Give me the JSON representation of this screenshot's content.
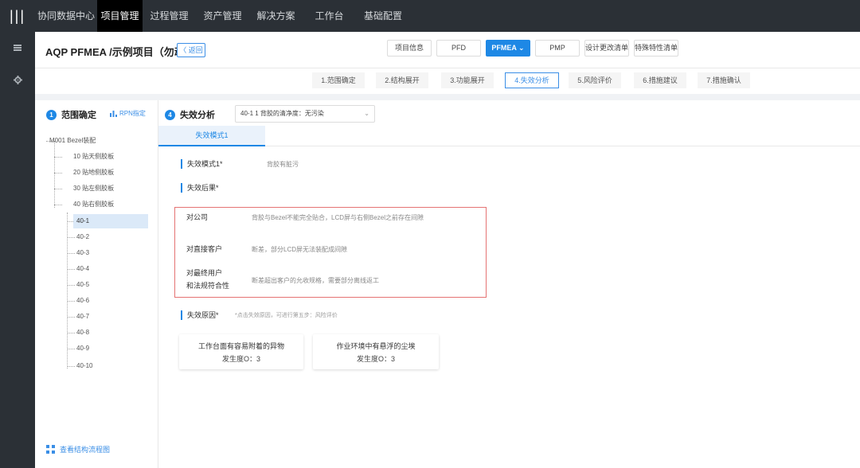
{
  "topnav": {
    "items": [
      {
        "label": "协同数据中心",
        "active": false
      },
      {
        "label": "项目管理",
        "active": true
      },
      {
        "label": "过程管理",
        "active": false
      },
      {
        "label": "资产管理",
        "active": false
      },
      {
        "label": "解决方案",
        "active": false
      },
      {
        "label": "工作台",
        "active": false
      },
      {
        "label": "基础配置",
        "active": false
      }
    ]
  },
  "header": {
    "title": "AQP PFMEA /示例项目（勿动）",
    "back_label": "〈 返回",
    "buttons": [
      "项目信息",
      "PFD",
      "PFMEA ⌄",
      "PMP",
      "设计更改清单",
      "特殊特性清单"
    ]
  },
  "steps": [
    "1.范围确定",
    "2.结构展开",
    "3.功能展开",
    "4.失效分析",
    "5.风险评价",
    "6.措施建议",
    "7.措施确认"
  ],
  "tree": {
    "step_number": "1",
    "title": "范围确定",
    "rpn_label": "RPN指定",
    "root": "M001 Bezel装配",
    "level1": [
      "10 贴天侧胶板",
      "20 贴地侧胶板",
      "30 贴左侧胶板",
      "40 贴右侧胶板"
    ],
    "level2": [
      "40-1",
      "40-2",
      "40-3",
      "40-4",
      "40-5",
      "40-6",
      "40-7",
      "40-8",
      "40-9",
      "40-10"
    ],
    "flow_link": "查看结构流程图"
  },
  "main": {
    "step_number": "4",
    "title": "失效分析",
    "select_value": "40-1 1 背胶的清净度：无污染",
    "tab": "失效模式1",
    "failure_mode_label": "失效模式1*",
    "failure_mode_value": "背胶有脏污",
    "effects_label": "失效后果*",
    "effects": [
      {
        "label": "对公司",
        "text": "背胶与Bezel不能完全贴合，LCD屏与右侧Bezel之前存在间隙"
      },
      {
        "label": "对直接客户",
        "text": "断差，部分LCD屏无法装配成间隙"
      },
      {
        "label": "对最终用户\n和法规符合性",
        "text": "断差超出客户的允收规格，需要部分离线返工"
      }
    ],
    "causes_label": "失效原因*",
    "causes_hint": "*点击失效原因，可进行第五步：风险评价",
    "causes": [
      {
        "title": "工作台面有容易附着的异物",
        "score": "发生度O：3"
      },
      {
        "title": "作业环境中有悬浮的尘埃",
        "score": "发生度O：3"
      }
    ]
  }
}
